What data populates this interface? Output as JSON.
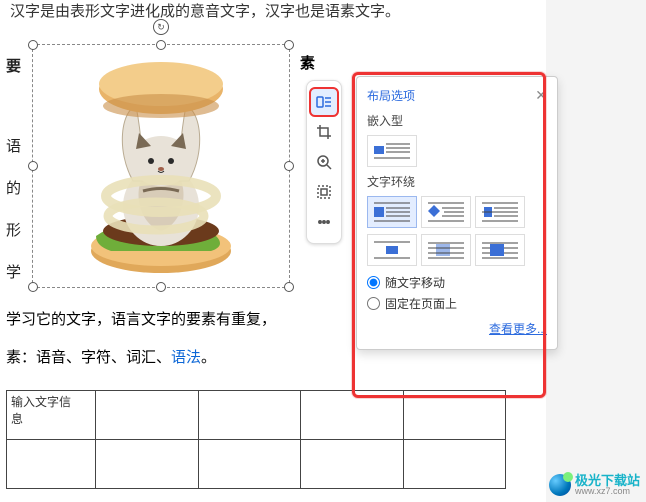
{
  "document": {
    "top_line": "汉字是由表形文字进化成的意音文字，汉字也是语素文字。",
    "left_chars": [
      "要",
      "语",
      "的",
      "形",
      "学"
    ],
    "right_char": "素",
    "para_line": "学习它的文字，语言文字的要素有重复，",
    "list_line_prefix": "素：语音、字符、词汇、",
    "list_line_link": "语法",
    "list_line_suffix": "。",
    "table_cell1_l1": "输入文字信",
    "table_cell1_l2": "息"
  },
  "toolbar": {
    "items": [
      {
        "name": "layout-options-icon",
        "active": true
      },
      {
        "name": "crop-icon"
      },
      {
        "name": "zoom-icon"
      },
      {
        "name": "select-icon"
      },
      {
        "name": "more-icon"
      }
    ]
  },
  "popup": {
    "title": "布局选项",
    "section_inline": "嵌入型",
    "section_wrap": "文字环绕",
    "radio_move": "随文字移动",
    "radio_fixed": "固定在页面上",
    "see_more": "查看更多...",
    "wrap_options": [
      "square",
      "tight",
      "through",
      "top-bottom",
      "behind",
      "front"
    ]
  },
  "watermark": {
    "name": "极光下载站",
    "url": "www.xz7.com"
  }
}
